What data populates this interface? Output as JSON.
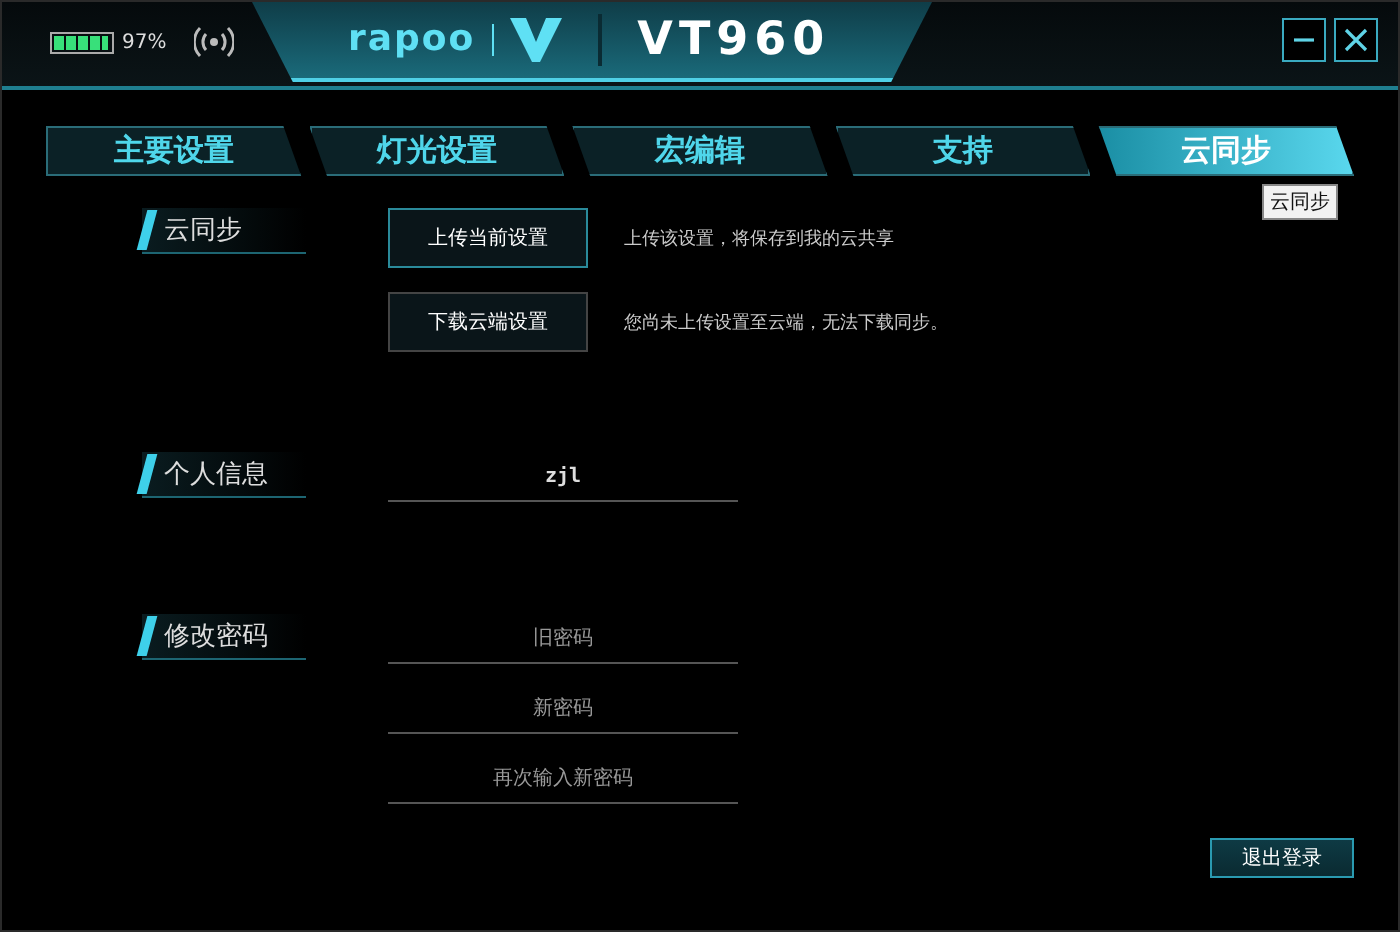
{
  "battery": {
    "level": 0.97,
    "reading": "97%"
  },
  "logo": "rapoo",
  "title": "VT960",
  "tabs": [
    {
      "label": "主要设置",
      "selected": false
    },
    {
      "label": "灯光设置",
      "selected": false
    },
    {
      "label": "宏编辑",
      "selected": false
    },
    {
      "label": "支持",
      "selected": false
    },
    {
      "label": "云同步",
      "selected": true
    }
  ],
  "tooltip": "云同步",
  "sync": {
    "heading": "云同步",
    "actions": [
      {
        "button": "上传当前设置",
        "note": "上传该设置，将保存到我的云共享"
      },
      {
        "button": "下载云端设置",
        "note": "您尚未上传设置至云端，无法下载同步。"
      }
    ]
  },
  "profile": {
    "heading": "个人信息",
    "username": "zjl"
  },
  "password": {
    "heading": "修改密码",
    "fields": [
      {
        "placeholder": "旧密码"
      },
      {
        "placeholder": "新密码"
      },
      {
        "placeholder": "再次输入新密码"
      }
    ]
  },
  "logout": "退出登录"
}
